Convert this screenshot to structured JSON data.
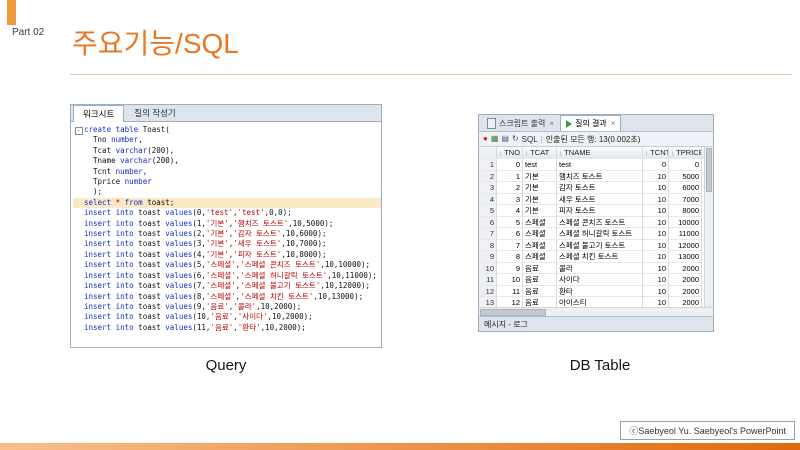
{
  "slide": {
    "part_label": "Part 02",
    "title": "주요기능/SQL",
    "caption_query": "Query",
    "caption_db": "DB Table",
    "credit": "ⓒSaebyeol Yu. Saebyeol's PowerPoint",
    "accent_color": "#e87722"
  },
  "editor": {
    "tabs": [
      {
        "label": "워크시트",
        "active": true
      },
      {
        "label": "질의 작성기",
        "active": false
      }
    ],
    "highlight_line": 7,
    "code_lines": [
      "create table Toast(",
      "  Tno number,",
      "  Tcat varchar(200),",
      "  Tname varchar(200),",
      "  Tcnt number,",
      "  Tprice number",
      "  );",
      "select * from toast;",
      "",
      "insert into toast values(0,'test','test',0,0);",
      "insert into toast values(1,'기본','햄치즈 토스트',10,5000);",
      "insert into toast values(2,'기본','감자 토스트',10,6000);",
      "insert into toast values(3,'기본','새우 토스트',10,7000);",
      "insert into toast values(4,'기본','피자 토스트',10,8000);",
      "insert into toast values(5,'스페셜','스페셜 콘치즈 토스트',10,10000);",
      "insert into toast values(6,'스페셜','스페셜 허니갈릭 토스트',10,11000);",
      "insert into toast values(7,'스페셜','스페셜 불고기 토스트',10,12000);",
      "insert into toast values(8,'스페셜','스페셜 치킨 토스트',10,13000);",
      "insert into toast values(9,'음료','콜라',10,2000);",
      "insert into toast values(10,'음료','사이다',10,2000);",
      "insert into toast values(11,'음료','환타',10,2000);"
    ]
  },
  "results": {
    "tabs": [
      {
        "label": "스크립트 출력",
        "icon": "script",
        "active": false
      },
      {
        "label": "질의 결과",
        "icon": "query-result",
        "active": true
      }
    ],
    "toolbar": {
      "icons": [
        {
          "name": "pin",
          "glyph": "●"
        },
        {
          "name": "grid-export",
          "glyph": "▦"
        },
        {
          "name": "save-grid",
          "glyph": "▤"
        },
        {
          "name": "refresh",
          "glyph": "↻"
        }
      ],
      "sql_label": "SQL",
      "separator": "|",
      "status": "인출된 모든 행: 13(0.002초)"
    },
    "columns": [
      "TNO",
      "TCAT",
      "TNAME",
      "TCNT",
      "TPRICE"
    ],
    "rows": [
      [
        0,
        "test",
        "test",
        0,
        0
      ],
      [
        1,
        "기본",
        "햄치즈 토스트",
        10,
        5000
      ],
      [
        2,
        "기본",
        "감자 토스트",
        10,
        6000
      ],
      [
        3,
        "기본",
        "새우 토스트",
        10,
        7000
      ],
      [
        4,
        "기본",
        "피자 토스트",
        10,
        8000
      ],
      [
        5,
        "스페셜",
        "스페셜 콘치즈 토스트",
        10,
        10000
      ],
      [
        6,
        "스페셜",
        "스페셜 허니갈릭 토스트",
        10,
        11000
      ],
      [
        7,
        "스페셜",
        "스페셜 불고기 토스트",
        10,
        12000
      ],
      [
        8,
        "스페셜",
        "스페셜 치킨 토스트",
        10,
        13000
      ],
      [
        9,
        "음료",
        "콜라",
        10,
        2000
      ],
      [
        10,
        "음료",
        "사이다",
        10,
        2000
      ],
      [
        11,
        "음료",
        "환타",
        10,
        2000
      ],
      [
        12,
        "음료",
        "아이스티",
        10,
        2000
      ]
    ],
    "message_tab": "메시지 - 로그"
  }
}
